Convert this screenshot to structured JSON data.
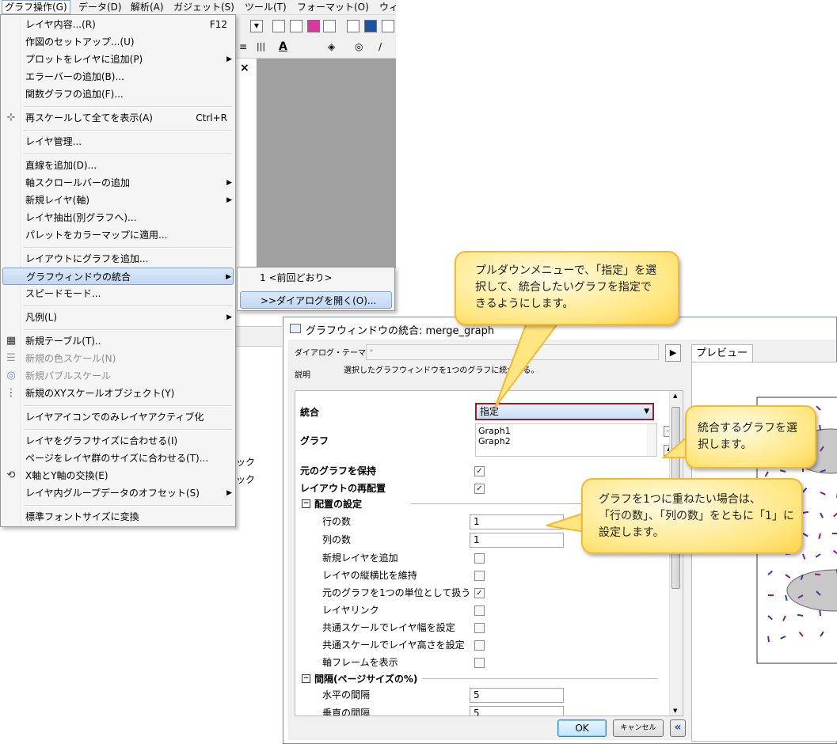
{
  "menubar": {
    "items": [
      "グラフ操作(G)",
      "データ(D)",
      "解析(A)",
      "ガジェット(S)",
      "ツール(T)",
      "フォーマット(O)",
      "ウィ"
    ]
  },
  "background": {
    "close_glyph": "×",
    "frag1": "ック",
    "frag2": "ック"
  },
  "menu": {
    "items": [
      {
        "label": "レイヤ内容...(R)",
        "shortcut": "F12"
      },
      {
        "label": "作図のセットアップ...(U)"
      },
      {
        "label": "プロットをレイヤに追加(P)",
        "arrow": "▶"
      },
      {
        "label": "エラーバーの追加(B)..."
      },
      {
        "label": "関数グラフの追加(F)..."
      },
      {
        "label": "再スケールして全てを表示(A)",
        "shortcut": "Ctrl+R",
        "icon": "rescale-icon"
      },
      {
        "label": "レイヤ管理..."
      },
      {
        "label": "直線を追加(D)..."
      },
      {
        "label": "軸スクロールバーの追加",
        "arrow": "▶"
      },
      {
        "label": "新規レイヤ(軸)",
        "arrow": "▶"
      },
      {
        "label": "レイヤ抽出(別グラフへ)..."
      },
      {
        "label": "パレットをカラーマップに適用..."
      },
      {
        "label": "レイアウトにグラフを追加..."
      },
      {
        "label": "グラフウィンドウの統合",
        "arrow": "▶"
      },
      {
        "label": "スピードモード..."
      },
      {
        "label": "凡例(L)",
        "arrow": "▶"
      },
      {
        "label": "新規テーブル(T)..",
        "icon": "table-icon"
      },
      {
        "label": "新規の色スケール(N)",
        "icon": "color-scale-icon"
      },
      {
        "label": "新規バブルスケール",
        "icon": "bubble-scale-icon"
      },
      {
        "label": "新規のXYスケールオブジェクト(Y)",
        "icon": "xy-scale-icon"
      },
      {
        "label": "レイヤアイコンでのみレイヤアクティブ化"
      },
      {
        "label": "レイヤをグラフサイズに合わせる(I)"
      },
      {
        "label": "ページをレイヤ群のサイズに合わせる(T)..."
      },
      {
        "label": "X軸とY軸の交換(E)",
        "icon": "swap-axes-icon"
      },
      {
        "label": "レイヤ内グループデータのオフセット(S)",
        "arrow": "▶"
      },
      {
        "label": "標準フォントサイズに変換"
      }
    ]
  },
  "submenu": {
    "previous": "1 <前回どおり>",
    "open_dialog": ">>ダイアログを開く(O)..."
  },
  "dialog": {
    "title": "グラフウィンドウの統合: merge_graph",
    "theme_label": "ダイアログ・テーマ(H)",
    "theme_value": "*",
    "play_glyph": "▶",
    "desc_label": "説明",
    "desc_text": "選択したグラフウィンドウを1つのグラフに統合する。",
    "merge_label": "統合",
    "merge_value": "指定",
    "graph_label": "グラフ",
    "graphs": [
      "Graph1",
      "Graph2"
    ],
    "keep_source_label": "元のグラフを保持",
    "rearrange_label": "レイアウトの再配置",
    "arrange_group": "配置の設定",
    "rows_label": "行の数",
    "rows_value": "1",
    "cols_label": "列の数",
    "cols_value": "1",
    "add_layer_label": "新規レイヤを追加",
    "keep_ratio_label": "レイヤの縦横比を維持",
    "as_unit_label": "元のグラフを1つの単位として扱う",
    "layer_link_label": "レイヤリンク",
    "common_width_label": "共通スケールでレイヤ幅を設定",
    "common_height_label": "共通スケールでレイヤ高さを設定",
    "axis_frame_label": "軸フレームを表示",
    "spacing_group": "間隔(ページサイズの%)",
    "h_gap_label": "水平の間隔",
    "h_gap_value": "5",
    "v_gap_label": "垂直の間隔",
    "v_gap_value": "5",
    "checks": {
      "keep_source": true,
      "rearrange": true,
      "add_layer": false,
      "keep_ratio": false,
      "as_unit": true,
      "layer_link": false,
      "common_width": false,
      "common_height": false,
      "axis_frame": false
    },
    "preview_tab": "プレビュー",
    "ok_label": "OK",
    "cancel_label": "キャンセル",
    "collapse_glyph": "«"
  },
  "callouts": {
    "top": [
      "プルダウンメニューで、「指定」を選",
      "択して、統合したいグラフを指定で",
      "きるようにします。"
    ],
    "right": [
      "統合するグラフを選",
      "択します。"
    ],
    "middle": [
      "グラフを1つに重ねたい場合は、",
      "「行の数」、「列の数」をともに「1」に",
      "設定します。"
    ]
  },
  "colors": {
    "callout_fill": "#ffe680",
    "callout_border": "#f2b93a",
    "highlight": "#c2d8f3",
    "combo_outline": "#a31c22"
  }
}
